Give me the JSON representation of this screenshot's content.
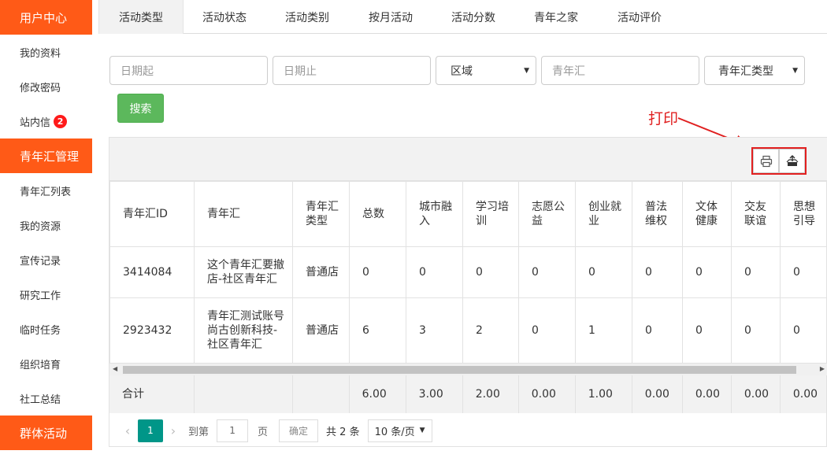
{
  "sidebar": {
    "groups": [
      {
        "label": "用户中心"
      },
      {
        "label": "青年汇管理"
      },
      {
        "label": "群体活动"
      }
    ],
    "user_items": [
      {
        "label": "我的资料"
      },
      {
        "label": "修改密码"
      },
      {
        "label": "站内信",
        "badge": "2"
      }
    ],
    "manage_items": [
      {
        "label": "青年汇列表"
      },
      {
        "label": "我的资源"
      },
      {
        "label": "宣传记录"
      },
      {
        "label": "研究工作"
      },
      {
        "label": "临时任务"
      },
      {
        "label": "组织培育"
      },
      {
        "label": "社工总结"
      }
    ]
  },
  "tabs": [
    {
      "label": "活动类型",
      "active": true
    },
    {
      "label": "活动状态"
    },
    {
      "label": "活动类别"
    },
    {
      "label": "按月活动"
    },
    {
      "label": "活动分数"
    },
    {
      "label": "青年之家"
    },
    {
      "label": "活动评价"
    }
  ],
  "filters": {
    "date_start_placeholder": "日期起",
    "date_end_placeholder": "日期止",
    "region_select": "区域",
    "youth_club_placeholder": "青年汇",
    "club_type_select": "青年汇类型",
    "search_button": "搜索"
  },
  "annotation": {
    "label": "打印",
    "color": "#e02020"
  },
  "toolbar": {
    "icons": [
      "print-icon",
      "export-icon"
    ]
  },
  "table": {
    "headers": [
      "青年汇ID",
      "青年汇",
      "青年汇类型",
      "总数",
      "城市融入",
      "学习培训",
      "志愿公益",
      "创业就业",
      "普法维权",
      "文体健康",
      "交友联谊",
      "思想引导"
    ],
    "rows": [
      [
        "3414084",
        "这个青年汇要撤店-社区青年汇",
        "普通店",
        "0",
        "0",
        "0",
        "0",
        "0",
        "0",
        "0",
        "0",
        "0"
      ],
      [
        "2923432",
        "青年汇测试账号尚古创新科技-社区青年汇",
        "普通店",
        "6",
        "3",
        "2",
        "0",
        "1",
        "0",
        "0",
        "0",
        "0"
      ]
    ],
    "total": [
      "合计",
      "",
      "",
      "6.00",
      "3.00",
      "2.00",
      "0.00",
      "1.00",
      "0.00",
      "0.00",
      "0.00",
      "0.00"
    ]
  },
  "pager": {
    "current_page": "1",
    "goto_label": "到第",
    "goto_value": "1",
    "page_unit": "页",
    "confirm": "确定",
    "total_text": "共 2 条",
    "page_size": "10 条/页"
  },
  "colors": {
    "brand": "#ff5a17",
    "search": "#5cb85c",
    "pager_active": "#009688"
  }
}
